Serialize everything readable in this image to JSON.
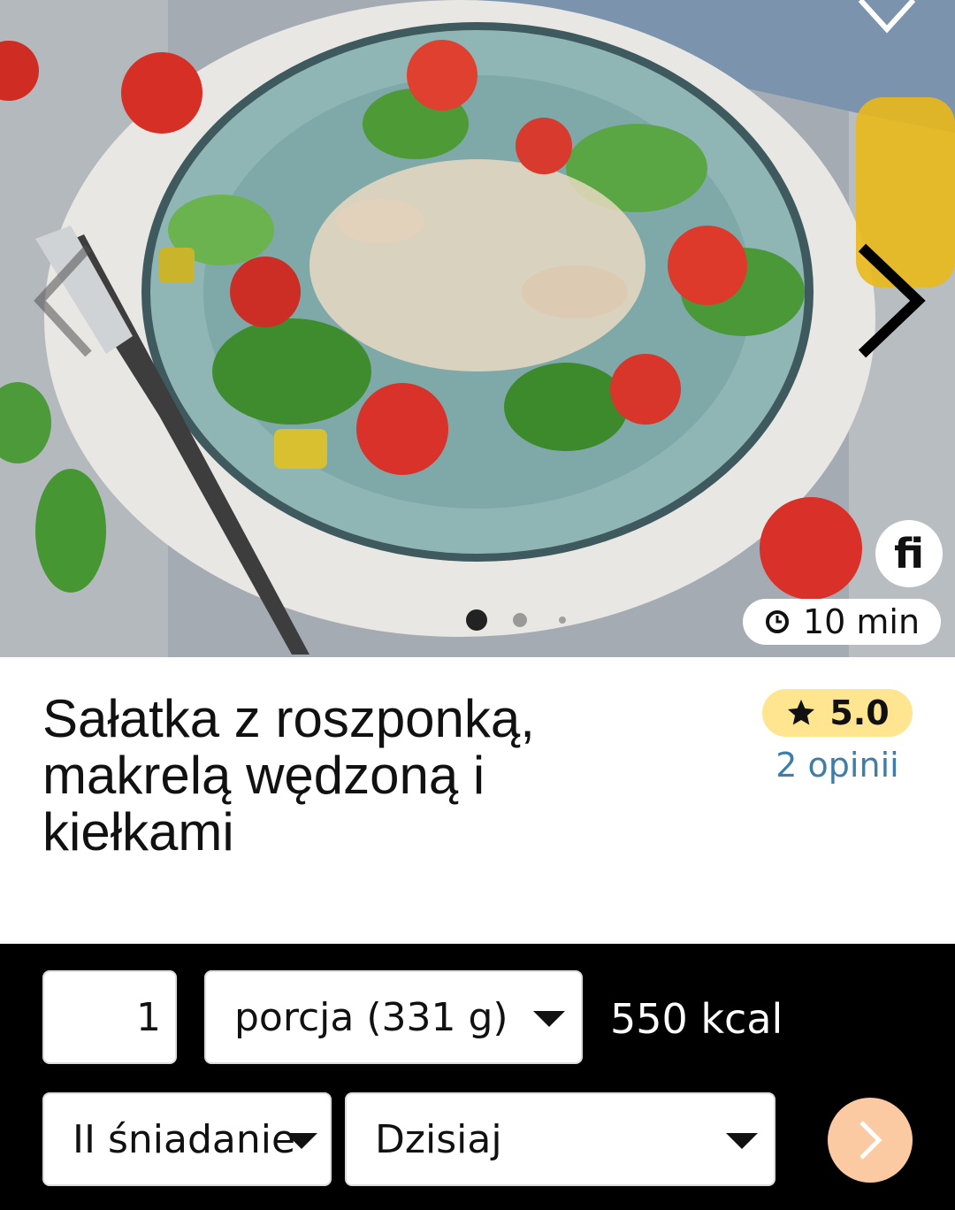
{
  "recipe": {
    "title": "Sałatka z roszponką, makrelą wędzoną i kiełkami",
    "time": "10 min",
    "rating": "5.0",
    "reviews": "2 opinii",
    "brand_logo": "fi"
  },
  "gallery": {
    "total_slides": 3,
    "active_slide": 1
  },
  "controls": {
    "quantity": "1",
    "portion": "porcja (331 g)",
    "kcal": "550 kcal",
    "meal": "II śniadanie",
    "day": "Dzisiaj"
  },
  "icons": {
    "prev": "chevron-left-icon",
    "next": "chevron-right-icon",
    "favorite": "heart-icon",
    "time": "clock-icon",
    "rating": "star-icon",
    "go": "chevron-right-icon"
  },
  "colors": {
    "rating_bg": "#ffe58f",
    "reviews_link": "#3f7ea8",
    "go_button": "#fbc9a2",
    "controls_bg": "#000000"
  }
}
